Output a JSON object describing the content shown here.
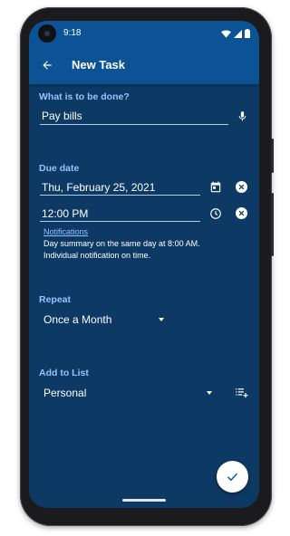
{
  "status_bar": {
    "time": "9:18",
    "icons": [
      "wifi-icon",
      "signal-icon",
      "battery-icon"
    ]
  },
  "app_bar": {
    "title": "New Task",
    "back_icon": "arrow-back-icon"
  },
  "task": {
    "label": "What is to be done?",
    "value": "Pay bills",
    "voice_icon": "microphone-icon"
  },
  "due_date": {
    "label": "Due date",
    "date_value": "Thu, February 25, 2021",
    "time_value": "12:00 PM",
    "calendar_icon": "calendar-icon",
    "clock_icon": "clock-icon",
    "clear_icon": "clear-icon"
  },
  "notifications": {
    "link": "Notifications",
    "line1": "Day summary on the same day at 8:00 AM.",
    "line2": "Individual notification on time."
  },
  "repeat": {
    "label": "Repeat",
    "selected": "Once a Month"
  },
  "list": {
    "label": "Add to List",
    "selected": "Personal",
    "add_list_icon": "playlist-add-icon"
  },
  "fab": {
    "icon": "check-icon"
  },
  "colors": {
    "background": "#0d3a64",
    "app_bar": "#0b5394",
    "accent_label": "#8fc4ff"
  }
}
